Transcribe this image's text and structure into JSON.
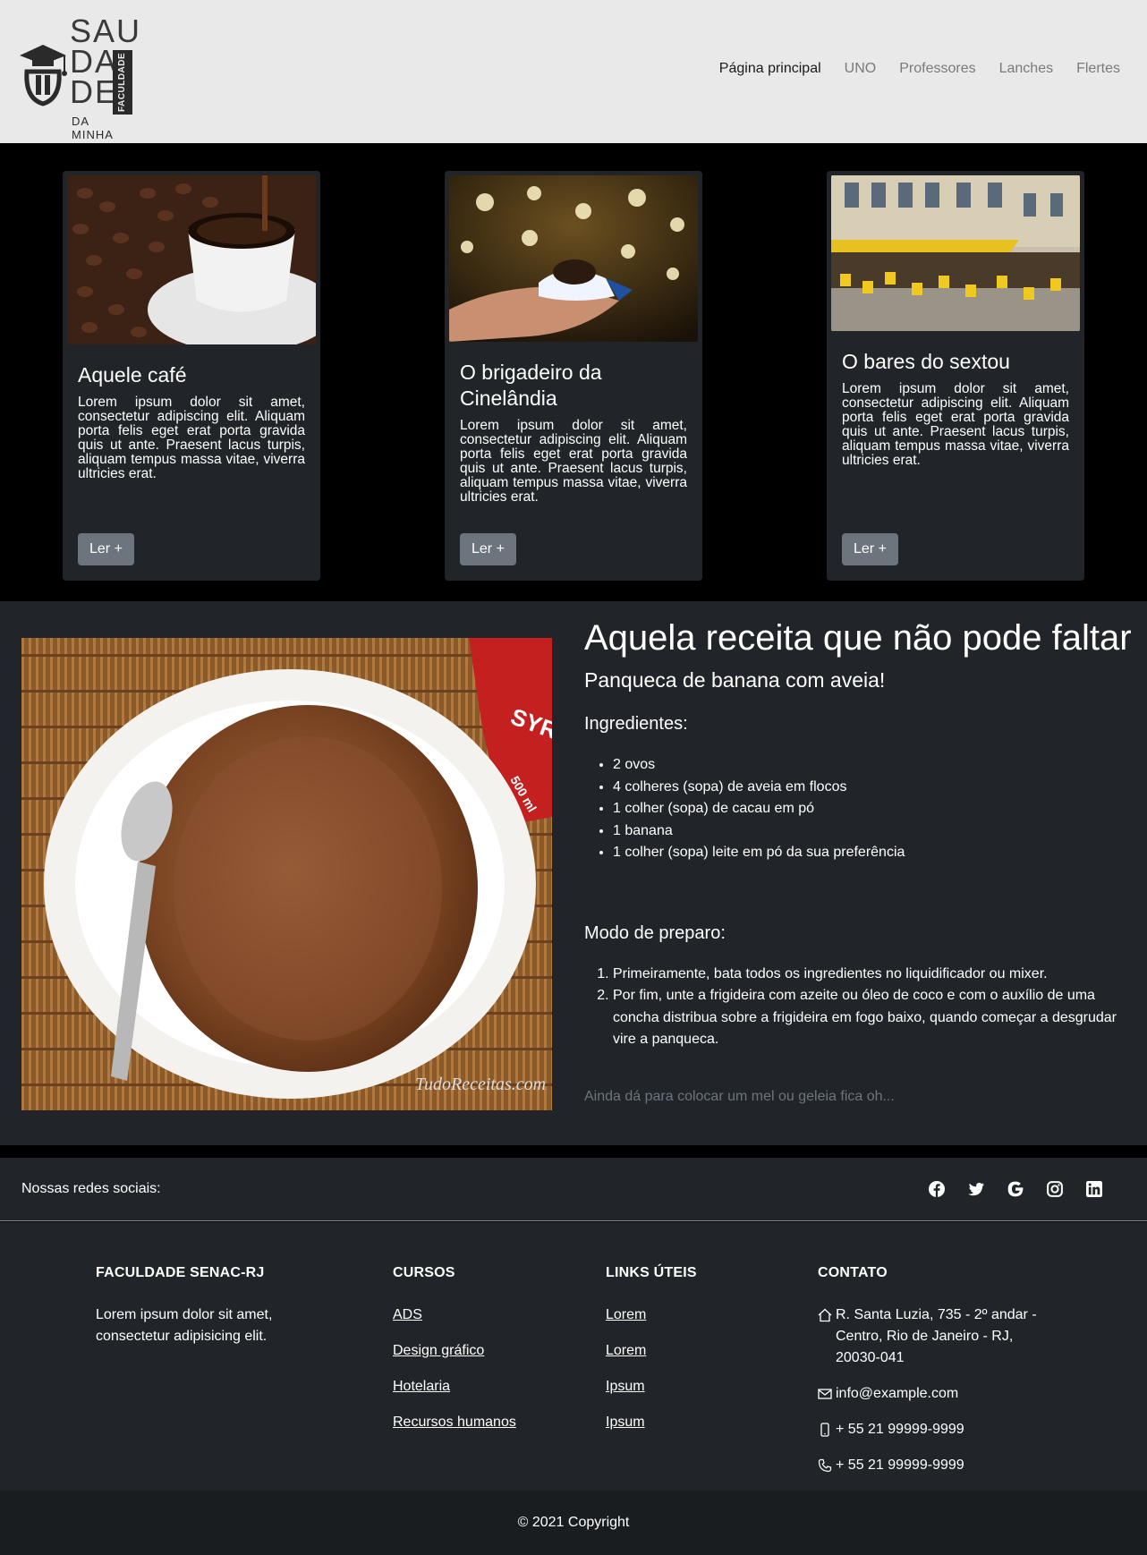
{
  "nav": {
    "logo": {
      "line1": "SAU",
      "line2": "DA",
      "line3": "DE",
      "vertical": "FACULDADE",
      "sub": "DA MINHA"
    },
    "links": [
      "Página principal",
      "UNO",
      "Professores",
      "Lanches",
      "Flertes"
    ]
  },
  "cards": [
    {
      "title": "Aquele café",
      "text": "Lorem ipsum dolor sit amet, consectetur adipiscing elit. Aliquam porta felis eget erat porta gravida quis ut ante. Praesent lacus turpis, aliquam tempus massa vitae, viverra ultricies erat.",
      "button": "Ler +"
    },
    {
      "title": "O brigadeiro da Cinelândia",
      "text": "Lorem ipsum dolor sit amet, consectetur adipiscing elit. Aliquam porta felis eget erat porta gravida quis ut ante. Praesent lacus turpis, aliquam tempus massa vitae, viverra ultricies erat.",
      "button": "Ler +"
    },
    {
      "title": "O bares do sextou",
      "text": "Lorem ipsum dolor sit amet, consectetur adipiscing elit. Aliquam porta felis eget erat porta gravida quis ut ante. Praesent lacus turpis, aliquam tempus massa vitae, viverra ultricies erat.",
      "button": "Ler +"
    }
  ],
  "recipe": {
    "title": "Aquela receita que não pode faltar",
    "subtitle": "Panqueca de banana com aveia!",
    "ingredients_heading": "Ingredientes:",
    "ingredients": [
      "2 ovos",
      "4 colheres (sopa) de aveia em flocos",
      "1 colher (sopa) de cacau em pó",
      "1 banana",
      "1 colher (sopa) leite em pó da sua preferência"
    ],
    "steps_heading": "Modo de preparo:",
    "steps": [
      "Primeiramente, bata todos os ingredientes no liquidificador ou mixer.",
      "Por fim, unte a frigideira com azeite ou óleo de coco e com o auxílio de uma concha distribua sobre a frigideira em fogo baixo, quando começar a desgrudar vire a panqueca."
    ],
    "note": "Ainda dá para colocar um mel ou geleia fica oh...",
    "watermark": "TudoReceitas.com",
    "syrup_label": "SYR",
    "syrup_size": "500 ml"
  },
  "social": {
    "label": "Nossas redes sociais:",
    "icons": [
      "facebook-icon",
      "twitter-icon",
      "google-icon",
      "instagram-icon",
      "linkedin-icon"
    ]
  },
  "footer": {
    "about": {
      "heading": "FACULDADE SENAC-RJ",
      "text": "Lorem ipsum dolor sit amet, consectetur adipisicing elit."
    },
    "courses": {
      "heading": "CURSOS",
      "links": [
        "ADS",
        "Design gráfico",
        "Hotelaria",
        "Recursos humanos"
      ]
    },
    "useful": {
      "heading": "LINKS ÚTEIS",
      "links": [
        "Lorem",
        "Lorem",
        "Ipsum",
        "Ipsum"
      ]
    },
    "contact": {
      "heading": "CONTATO",
      "address": "R. Santa Luzia, 735 - 2º andar - Centro, Rio de Janeiro - RJ, 20030-041",
      "email": "info@example.com",
      "mobile": "+ 55 21 99999-9999",
      "phone": "+ 55 21 99999-9999"
    }
  },
  "copyright": "© 2021 Copyright"
}
